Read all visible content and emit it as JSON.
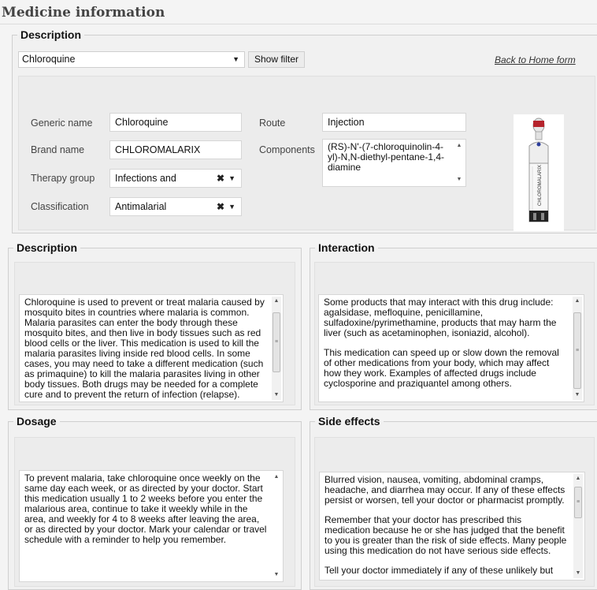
{
  "page": {
    "title": "Medicine information"
  },
  "top_section": {
    "legend": "Description",
    "medicine_select": "Chloroquine",
    "show_filter_label": "Show filter",
    "back_link": "Back to Home form"
  },
  "form": {
    "generic_name": {
      "label": "Generic name",
      "value": "Chloroquine"
    },
    "brand_name": {
      "label": "Brand name",
      "value": "CHLOROMALARIX"
    },
    "therapy_group": {
      "label": "Therapy group",
      "value": "Infections and"
    },
    "classification": {
      "label": "Classification",
      "value": "Antimalarial"
    },
    "route": {
      "label": "Route",
      "value": "Injection"
    },
    "components": {
      "label": "Components",
      "value": "(RS)-N'-(7-chloroquinolin-4-yl)-N,N-diethyl-pentane-1,4-diamine"
    },
    "image_label": "CHLOROMALARIX"
  },
  "panels": {
    "description": {
      "legend": "Description",
      "paragraphs": [
        "Chloroquine is used to prevent or treat malaria caused by mosquito bites in countries where malaria is common. Malaria parasites can enter the body through these mosquito bites, and then live in body tissues such as red blood cells or the liver. This medication is used to kill the malaria parasites living inside red blood cells. In some cases, you may need to take a different medication (such as primaquine) to kill the malaria parasites living in other body tissues. Both drugs may be needed for a complete cure and to prevent the return of infection (relapse)."
      ]
    },
    "interaction": {
      "legend": "Interaction",
      "paragraphs": [
        "Some products that may interact with this drug include: agalsidase, mefloquine, penicillamine, sulfadoxine/pyrimethamine, products that may harm the liver (such as acetaminophen, isoniazid, alcohol).",
        "This medication can speed up or slow down the removal of other medications from your body, which may affect how they work. Examples of affected drugs include cyclosporine and praziquantel among others."
      ]
    },
    "dosage": {
      "legend": "Dosage",
      "paragraphs": [
        "To prevent malaria, take chloroquine once weekly on the same day each week, or as directed by your doctor. Start this medication usually 1 to 2 weeks before you enter the malarious area, continue to take it weekly while in the area, and weekly for 4 to 8 weeks after leaving the area, or as directed by your doctor. Mark your calendar or travel schedule with a reminder to help you remember."
      ]
    },
    "side_effects": {
      "legend": "Side effects",
      "paragraphs": [
        "Blurred vision, nausea, vomiting, abdominal cramps, headache, and diarrhea may occur. If any of these effects persist or worsen, tell your doctor or pharmacist promptly.",
        "Remember that your doctor has prescribed this medication because he or she has judged that the benefit to you is greater than the risk of side effects. Many people using this medication do not have serious side effects.",
        "Tell your doctor immediately if any of these unlikely but"
      ]
    }
  }
}
